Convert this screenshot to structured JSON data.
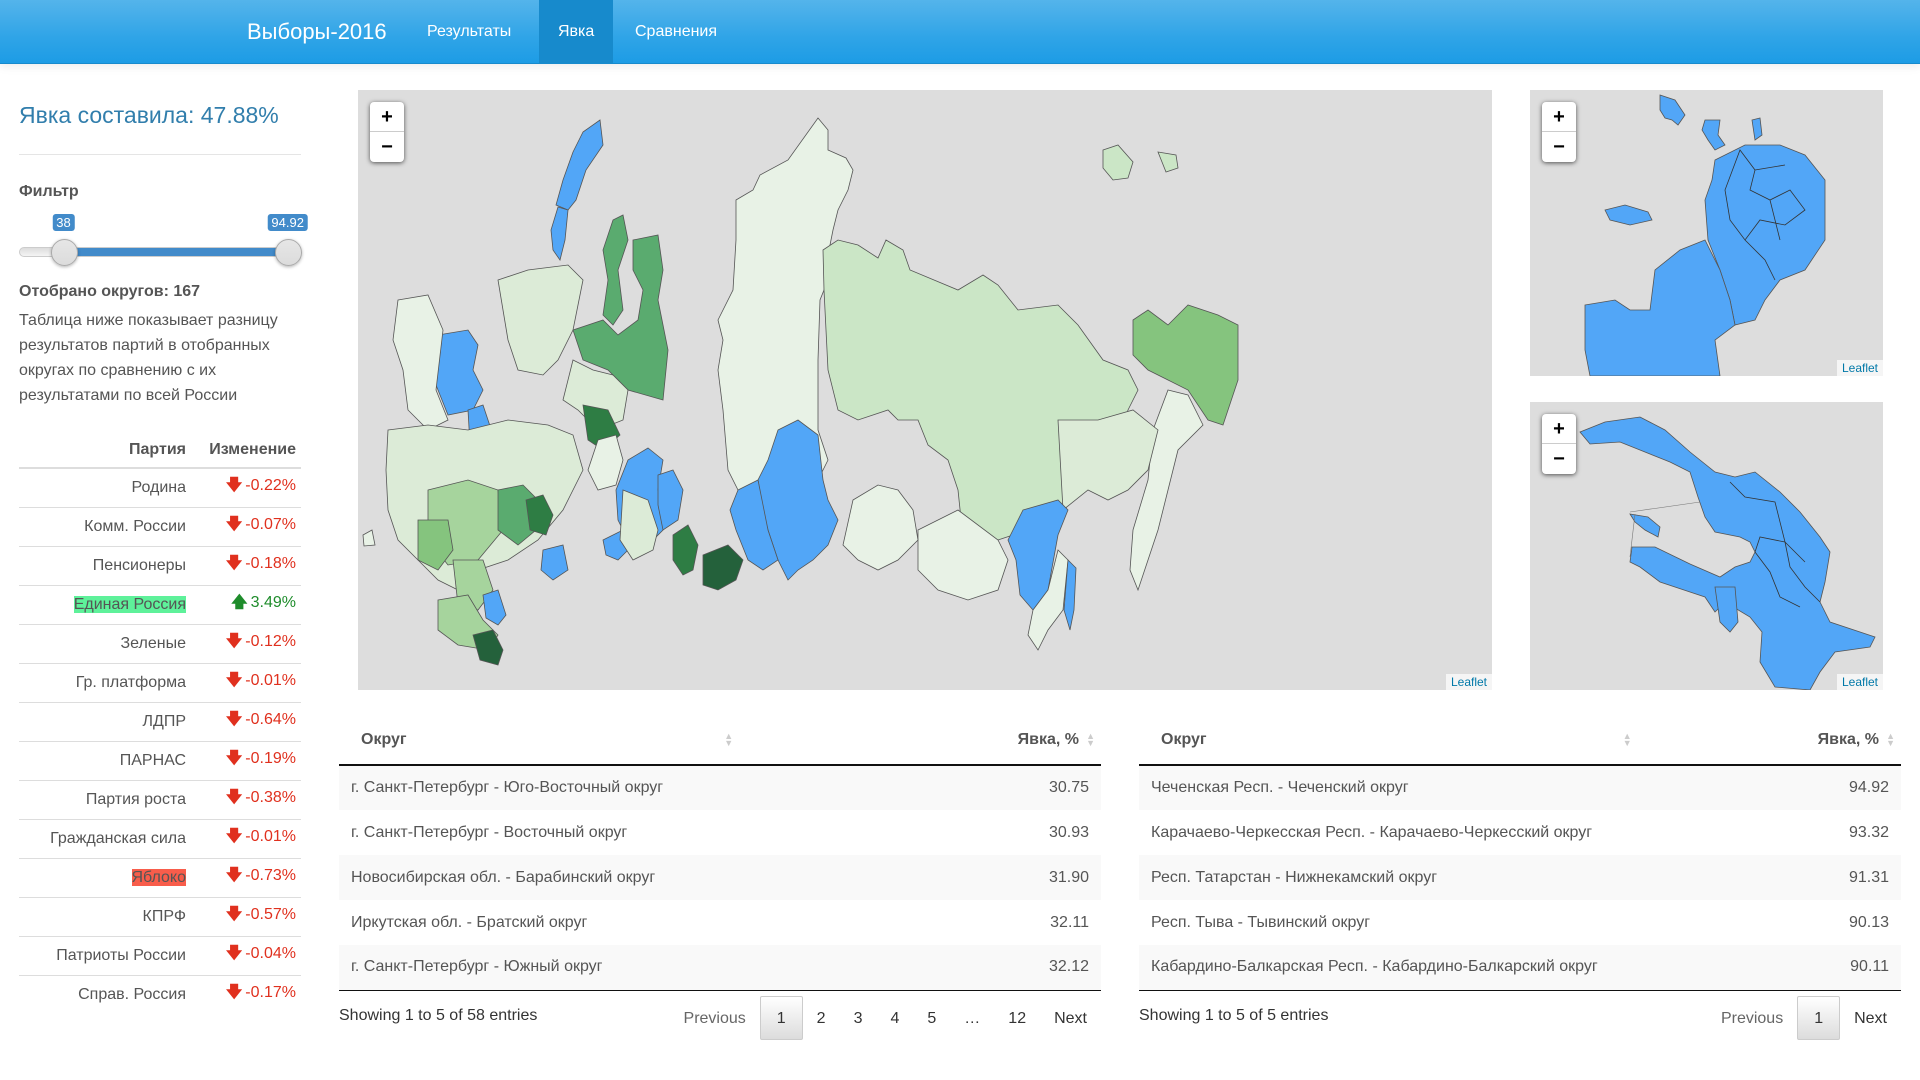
{
  "navbar": {
    "brand": "Выборы-2016",
    "tabs": [
      {
        "label": "Результаты",
        "active": false
      },
      {
        "label": "Явка",
        "active": true
      },
      {
        "label": "Сравнения",
        "active": false
      }
    ]
  },
  "sidebar": {
    "turnout_title": "Явка составила: 47.88%",
    "filter_label": "Фильтр",
    "slider": {
      "min": 0,
      "max": 100,
      "from": 38,
      "to": 94.92,
      "from_label": "38",
      "to_label": "94.92"
    },
    "selected_count": "Отобрано округов: 167",
    "explanation": "Таблица ниже показывает разницу результатов партий в отобранных округах по сравнению с их результатами по всей России",
    "party_table": {
      "headers": [
        "Партия",
        "Изменение"
      ],
      "rows": [
        {
          "party": "Родина",
          "change": "-0.22%",
          "direction": "down",
          "highlight": ""
        },
        {
          "party": "Комм. России",
          "change": "-0.07%",
          "direction": "down",
          "highlight": ""
        },
        {
          "party": "Пенсионеры",
          "change": "-0.18%",
          "direction": "down",
          "highlight": ""
        },
        {
          "party": "Единая Россия",
          "change": "3.49%",
          "direction": "up",
          "highlight": "green"
        },
        {
          "party": "Зеленые",
          "change": "-0.12%",
          "direction": "down",
          "highlight": ""
        },
        {
          "party": "Гр. платформа",
          "change": "-0.01%",
          "direction": "down",
          "highlight": ""
        },
        {
          "party": "ЛДПР",
          "change": "-0.64%",
          "direction": "down",
          "highlight": ""
        },
        {
          "party": "ПАРНАС",
          "change": "-0.19%",
          "direction": "down",
          "highlight": ""
        },
        {
          "party": "Партия роста",
          "change": "-0.38%",
          "direction": "down",
          "highlight": ""
        },
        {
          "party": "Гражданская сила",
          "change": "-0.01%",
          "direction": "down",
          "highlight": ""
        },
        {
          "party": "Яблоко",
          "change": "-0.73%",
          "direction": "down",
          "highlight": "red"
        },
        {
          "party": "КПРФ",
          "change": "-0.57%",
          "direction": "down",
          "highlight": ""
        },
        {
          "party": "Патриоты России",
          "change": "-0.04%",
          "direction": "down",
          "highlight": ""
        },
        {
          "party": "Справ. Россия",
          "change": "-0.17%",
          "direction": "down",
          "highlight": ""
        }
      ]
    }
  },
  "maps": {
    "zoom_in": "+",
    "zoom_out": "−",
    "attribution": "Leaflet",
    "colors": {
      "background": "#dddddd",
      "selected": "#52a6f7",
      "turnout_scale": [
        "#e8f2e6",
        "#dcebd7",
        "#cbe6c6",
        "#a6d49d",
        "#85c47e",
        "#5aab6f",
        "#2e7d44",
        "#24613b"
      ]
    },
    "main": {
      "name": "Russia"
    },
    "inset_top": {
      "name": "Moscow"
    },
    "inset_bottom": {
      "name": "Saint Petersburg"
    }
  },
  "tables": {
    "lowest": {
      "headers": [
        "Округ",
        "Явка, %"
      ],
      "rows": [
        [
          "г. Санкт-Петербург - Юго-Восточный округ",
          "30.75"
        ],
        [
          "г. Санкт-Петербург - Восточный округ",
          "30.93"
        ],
        [
          "Новосибирская обл. - Барабинский округ",
          "31.90"
        ],
        [
          "Иркутская обл. - Братский округ",
          "32.11"
        ],
        [
          "г. Санкт-Петербург - Южный округ",
          "32.12"
        ]
      ],
      "info": "Showing 1 to 5 of 58 entries",
      "pager": {
        "previous": "Previous",
        "pages": [
          "1",
          "2",
          "3",
          "4",
          "5",
          "…",
          "12"
        ],
        "current": "1",
        "next": "Next"
      }
    },
    "highest": {
      "headers": [
        "Округ",
        "Явка, %"
      ],
      "rows": [
        [
          "Чеченская Респ. - Чеченский округ",
          "94.92"
        ],
        [
          "Карачаево-Черкесская Респ. - Карачаево-Черкесский округ",
          "93.32"
        ],
        [
          "Респ. Татарстан - Нижнекамский округ",
          "91.31"
        ],
        [
          "Респ. Тыва - Тывинский округ",
          "90.13"
        ],
        [
          "Кабардино-Балкарская Респ. - Кабардино-Балкарский округ",
          "90.11"
        ]
      ],
      "info": "Showing 1 to 5 of 5 entries",
      "pager": {
        "previous": "Previous",
        "pages": [
          "1"
        ],
        "current": "1",
        "next": "Next"
      }
    }
  }
}
